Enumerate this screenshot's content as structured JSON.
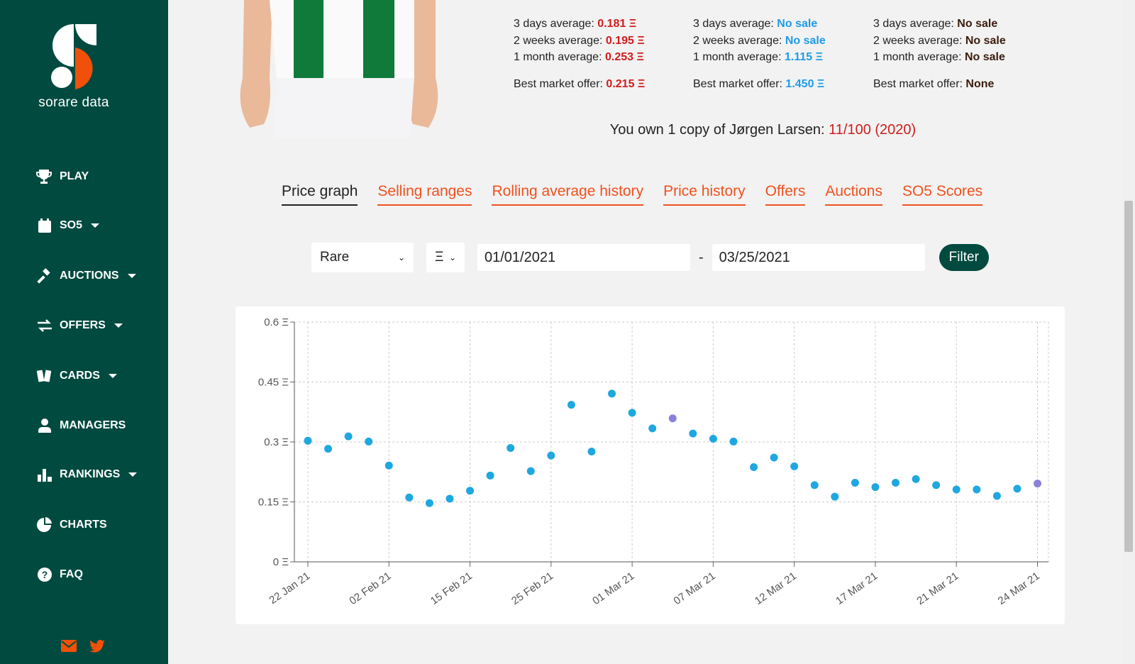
{
  "sidebar": {
    "brand": "sorare data",
    "logo_colors": {
      "white": "#ffffff",
      "orange": "#f0500a"
    },
    "items": [
      {
        "label": "PLAY",
        "icon": "trophy-icon",
        "dropdown": false
      },
      {
        "label": "SO5",
        "icon": "calendar-icon",
        "dropdown": true
      },
      {
        "label": "AUCTIONS",
        "icon": "gavel-icon",
        "dropdown": true
      },
      {
        "label": "OFFERS",
        "icon": "exchange-icon",
        "dropdown": true
      },
      {
        "label": "CARDS",
        "icon": "cards-icon",
        "dropdown": true
      },
      {
        "label": "MANAGERS",
        "icon": "user-tie-icon",
        "dropdown": false
      },
      {
        "label": "RANKINGS",
        "icon": "bar-chart-icon",
        "dropdown": true
      },
      {
        "label": "CHARTS",
        "icon": "pie-chart-icon",
        "dropdown": false
      },
      {
        "label": "FAQ",
        "icon": "question-circle-icon",
        "dropdown": false
      }
    ],
    "social": [
      "envelope-icon",
      "twitter-icon"
    ]
  },
  "stats": [
    {
      "three_days_label": "3 days average: ",
      "three_days": "0.181 Ξ",
      "two_weeks_label": "2 weeks average: ",
      "two_weeks": "0.195 Ξ",
      "month_label": "1 month average: ",
      "month": "0.253 Ξ",
      "offer_label": "Best market offer: ",
      "offer": "0.215 Ξ",
      "color": "#d01c1c"
    },
    {
      "three_days_label": "3 days average: ",
      "three_days": "No sale",
      "two_weeks_label": "2 weeks average: ",
      "two_weeks": "No sale",
      "month_label": "1 month average: ",
      "month": "1.115 Ξ",
      "offer_label": "Best market offer: ",
      "offer": "1.450 Ξ",
      "color": "#1e9be8"
    },
    {
      "three_days_label": "3 days average: ",
      "three_days": "No sale",
      "two_weeks_label": "2 weeks average: ",
      "two_weeks": "No sale",
      "month_label": "1 month average: ",
      "month": "No sale",
      "offer_label": "Best market offer: ",
      "offer": "None",
      "color": "#3a1d0e"
    }
  ],
  "ownership": {
    "prefix": "You own 1 copy of ",
    "player": "Jørgen Larsen",
    "suffix": ": ",
    "card": "11/100 (2020)"
  },
  "tabs": [
    {
      "label": "Price graph",
      "active": true
    },
    {
      "label": "Selling ranges",
      "active": false
    },
    {
      "label": "Rolling average history",
      "active": false
    },
    {
      "label": "Price history",
      "active": false
    },
    {
      "label": "Offers",
      "active": false
    },
    {
      "label": "Auctions",
      "active": false
    },
    {
      "label": "SO5 Scores",
      "active": false
    }
  ],
  "filters": {
    "rarity": "Rare",
    "currency": "Ξ",
    "start_date": "01/01/2021",
    "separator": "-",
    "end_date": "03/25/2021",
    "button": "Filter"
  },
  "colors": {
    "accent": "#f0511e",
    "sidebar": "#004a3f",
    "point": "#1ea7e1",
    "point_alt": "#8a82d8"
  },
  "chart_data": {
    "type": "scatter",
    "ylim": [
      0,
      0.6
    ],
    "yticks": [
      "0 Ξ",
      "0.15 Ξ",
      "0.3 Ξ",
      "0.45 Ξ",
      "0.6 Ξ"
    ],
    "ytick_values": [
      0,
      0.15,
      0.3,
      0.45,
      0.6
    ],
    "grid": true,
    "x_tick_labels": [
      "22 Jan 21",
      "02 Feb 21",
      "15 Feb 21",
      "25 Feb 21",
      "01 Mar 21",
      "07 Mar 21",
      "12 Mar 21",
      "17 Mar 21",
      "21 Mar 21",
      "24 Mar 21"
    ],
    "x_tick_every": 4,
    "values": [
      0.303,
      0.283,
      0.314,
      0.301,
      0.241,
      0.161,
      0.147,
      0.158,
      0.178,
      0.216,
      0.285,
      0.227,
      0.266,
      0.393,
      0.276,
      0.421,
      0.373,
      0.334,
      0.359,
      0.321,
      0.308,
      0.301,
      0.237,
      0.261,
      0.239,
      0.192,
      0.163,
      0.198,
      0.187,
      0.198,
      0.207,
      0.192,
      0.181,
      0.181,
      0.165,
      0.183,
      0.196
    ],
    "highlighted_indices": [
      18,
      36
    ]
  }
}
